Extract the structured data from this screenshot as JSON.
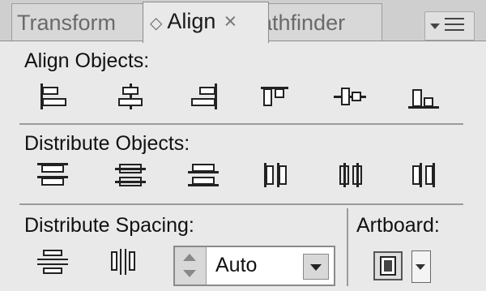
{
  "tabs": [
    {
      "label": "Transform",
      "active": false
    },
    {
      "label": "Align",
      "active": true
    },
    {
      "label": "Pathfinder",
      "visible_text": "athfinder",
      "active": false
    }
  ],
  "sections": {
    "align_objects": {
      "title": "Align Objects:",
      "buttons": [
        "horizontal-align-left-icon",
        "horizontal-align-center-icon",
        "horizontal-align-right-icon",
        "vertical-align-top-icon",
        "vertical-align-center-icon",
        "vertical-align-bottom-icon"
      ]
    },
    "distribute_objects": {
      "title": "Distribute Objects:",
      "buttons": [
        "vertical-distribute-top-icon",
        "vertical-distribute-center-icon",
        "vertical-distribute-bottom-icon",
        "horizontal-distribute-left-icon",
        "horizontal-distribute-center-icon",
        "horizontal-distribute-right-icon"
      ]
    },
    "distribute_spacing": {
      "title": "Distribute Spacing:",
      "spacing_value": "Auto"
    },
    "artboard": {
      "title": "Artboard:"
    }
  },
  "colors": {
    "panel_bg": "#e9e9e9",
    "icon_dark": "#333333",
    "icon_fill": "#eeeeee"
  }
}
